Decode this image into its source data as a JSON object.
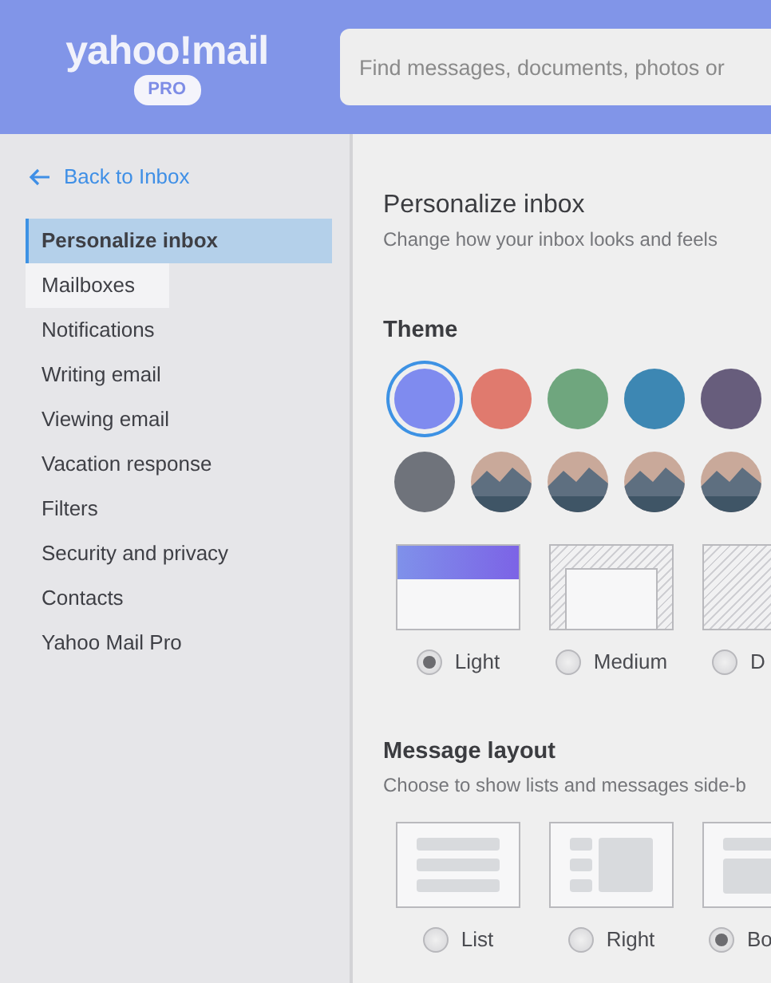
{
  "header": {
    "logo": {
      "wordmark": "yahoo!mail",
      "badge": "PRO"
    },
    "search": {
      "placeholder": "Find messages, documents, photos or"
    }
  },
  "sidebar": {
    "back_link": "Back to Inbox",
    "items": [
      {
        "label": "Personalize inbox",
        "selected": true,
        "hovered": false
      },
      {
        "label": "Mailboxes",
        "selected": false,
        "hovered": true
      },
      {
        "label": "Notifications",
        "selected": false,
        "hovered": false
      },
      {
        "label": "Writing email",
        "selected": false,
        "hovered": false
      },
      {
        "label": "Viewing email",
        "selected": false,
        "hovered": false
      },
      {
        "label": "Vacation response",
        "selected": false,
        "hovered": false
      },
      {
        "label": "Filters",
        "selected": false,
        "hovered": false
      },
      {
        "label": "Security and privacy",
        "selected": false,
        "hovered": false
      },
      {
        "label": "Contacts",
        "selected": false,
        "hovered": false
      },
      {
        "label": "Yahoo Mail Pro",
        "selected": false,
        "hovered": false
      }
    ]
  },
  "content": {
    "title": "Personalize inbox",
    "subtitle": "Change how your inbox looks and feels",
    "theme": {
      "heading": "Theme",
      "swatches": [
        {
          "kind": "solid",
          "color": "#7f8bef",
          "selected": true
        },
        {
          "kind": "solid",
          "color": "#e07a6e",
          "selected": false
        },
        {
          "kind": "solid",
          "color": "#6fa67e",
          "selected": false
        },
        {
          "kind": "solid",
          "color": "#3d87b3",
          "selected": false
        },
        {
          "kind": "solid",
          "color": "#675d7c",
          "selected": false
        },
        {
          "kind": "solid",
          "color": "#6f737b",
          "selected": false
        },
        {
          "kind": "photo",
          "selected": false
        },
        {
          "kind": "photo",
          "selected": false
        },
        {
          "kind": "photo",
          "selected": false
        },
        {
          "kind": "photo",
          "selected": false
        }
      ],
      "modes": [
        {
          "kind": "light",
          "label": "Light",
          "selected": true
        },
        {
          "kind": "medium",
          "label": "Medium",
          "selected": false
        },
        {
          "kind": "dark",
          "label": "D",
          "selected": false
        }
      ]
    },
    "message_layout": {
      "heading": "Message layout",
      "subtitle": "Choose to show lists and messages side-b",
      "options": [
        {
          "kind": "list",
          "label": "List",
          "selected": false
        },
        {
          "kind": "right",
          "label": "Right",
          "selected": false
        },
        {
          "kind": "bottom",
          "label": "Bo",
          "selected": true
        }
      ]
    }
  }
}
